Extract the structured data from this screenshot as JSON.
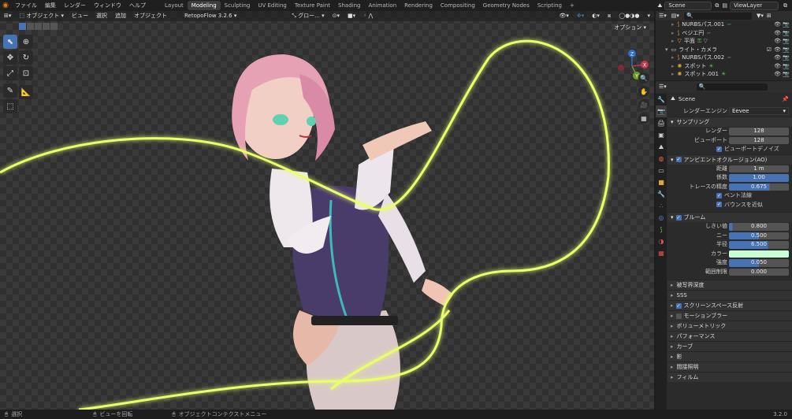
{
  "menu": {
    "items": [
      "ファイル",
      "編集",
      "レンダー",
      "ウィンドウ",
      "ヘルプ"
    ],
    "workspaces": [
      "Layout",
      "Modeling",
      "Sculpting",
      "UV Editing",
      "Texture Paint",
      "Shading",
      "Animation",
      "Rendering",
      "Compositing",
      "Geometry Nodes",
      "Scripting"
    ],
    "active_workspace": "Modeling",
    "scene": "Scene",
    "view_layer": "ViewLayer"
  },
  "viewport": {
    "mode": "オブジェクト",
    "menus": [
      "ビュー",
      "選択",
      "追加",
      "オブジェクト"
    ],
    "addon": "RetopoFlow 3.2.6",
    "orientation": "グロー...",
    "options": "オプション",
    "axes": {
      "x": "X",
      "y": "Y",
      "z": "Z"
    }
  },
  "outliner": {
    "rows": [
      {
        "indent": 2,
        "label": "NURBSパス.001",
        "icon": "curve-icon"
      },
      {
        "indent": 2,
        "label": "ベジエ円",
        "icon": "curve-icon"
      },
      {
        "indent": 2,
        "label": "平面",
        "icon": "mesh-icon"
      },
      {
        "indent": 1,
        "label": "ライト・カメラ",
        "icon": "collection-icon"
      },
      {
        "indent": 2,
        "label": "NURBSパス.002",
        "icon": "curve-icon"
      },
      {
        "indent": 2,
        "label": "スポット",
        "icon": "light-icon"
      },
      {
        "indent": 2,
        "label": "スポット.001",
        "icon": "light-icon"
      }
    ]
  },
  "properties": {
    "scene_name": "Scene",
    "render_engine_label": "レンダーエンジン",
    "render_engine": "Eevee",
    "sampling": {
      "title": "サンプリング",
      "render_label": "レンダー",
      "render": "128",
      "viewport_label": "ビューポート",
      "viewport": "128",
      "denoise": "ビューポートデノイズ"
    },
    "ao": {
      "title": "アンビエントオクルージョン(AO)",
      "distance_label": "距離",
      "distance": "1 m",
      "factor_label": "係数",
      "factor": "1.00",
      "precision_label": "トレースの精度",
      "precision": "0.675",
      "bent_normals": "ベント法線",
      "bounce": "バウンスを近似"
    },
    "bloom": {
      "title": "ブルーム",
      "threshold_label": "しきい値",
      "threshold": "0.800",
      "knee_label": "ニー",
      "knee": "0.500",
      "radius_label": "半径",
      "radius": "6.500",
      "color_label": "カラー",
      "color": "#c8ffd4",
      "intensity_label": "強度",
      "intensity": "0.050",
      "clamp_label": "範囲制限",
      "clamp": "0.000"
    },
    "panels": [
      "被写界深度",
      "SSS",
      "スクリーンスペース反射",
      "モーションブラー",
      "ボリューメトリック",
      "パフォーマンス",
      "カーブ",
      "影",
      "間接照明",
      "フィルム"
    ]
  },
  "status": {
    "select": "選択",
    "rotate": "ビューを回転",
    "context_menu": "オブジェクトコンテクストメニュー",
    "version": "3.2.0"
  }
}
